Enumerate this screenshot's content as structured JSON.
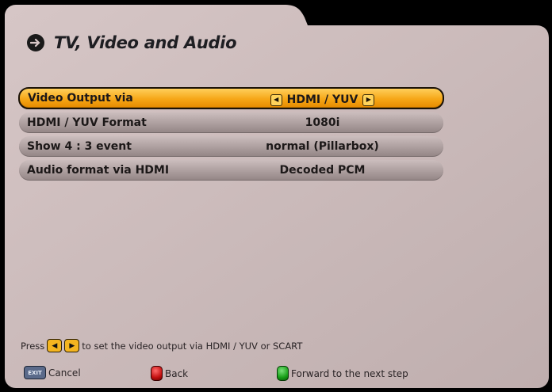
{
  "header": {
    "title": "TV, Video and Audio",
    "icon": "arrow-right-icon"
  },
  "menu": {
    "items": [
      {
        "label": "Video Output via",
        "value": "HDMI / YUV",
        "selected": true
      },
      {
        "label": "HDMI / YUV Format",
        "value": "1080i",
        "selected": false
      },
      {
        "label": "Show 4 : 3 event",
        "value": "normal (Pillarbox)",
        "selected": false
      },
      {
        "label": "Audio format via HDMI",
        "value": "Decoded PCM",
        "selected": false
      }
    ]
  },
  "help": {
    "prefix": "Press",
    "suffix": "to set the video output via HDMI / YUV or SCART"
  },
  "footer": {
    "exit_key": "EXIT",
    "cancel": "Cancel",
    "back": "Back",
    "forward": "Forward to the next step"
  },
  "colors": {
    "panel": "#c9b7b7",
    "selected_row": "#f6a616",
    "row": "#a99b9b",
    "background": "#000000"
  }
}
